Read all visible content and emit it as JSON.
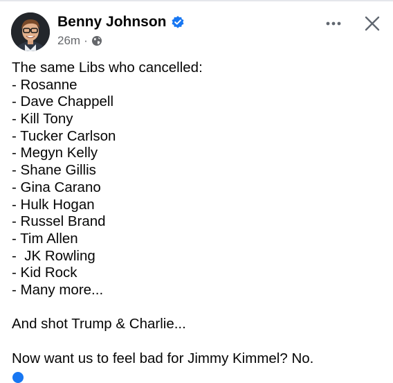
{
  "post": {
    "author": "Benny Johnson",
    "verified": true,
    "time": "26m",
    "separator": "·",
    "privacy_icon": "globe-icon",
    "header_icons": [
      "more-options-icon",
      "close-icon"
    ],
    "body": {
      "intro": "The same Libs who cancelled:",
      "list": [
        "- Rosanne",
        "- Dave Chappell",
        "- Kill Tony",
        "- Tucker Carlson",
        "- Megyn Kelly",
        "- Shane Gillis",
        "- Gina Carano",
        "- Hulk Hogan",
        "- Russel Brand",
        "- Tim Allen",
        "-  JK Rowling",
        "- Kid Rock",
        "- Many more..."
      ],
      "paragraph2": "And shot Trump & Charlie...",
      "paragraph3": "Now want us to feel bad for Jimmy Kimmel? No."
    }
  },
  "colors": {
    "text": "#050505",
    "secondary": "#65676b",
    "verified": "#1877f2",
    "icon": "#606770"
  }
}
